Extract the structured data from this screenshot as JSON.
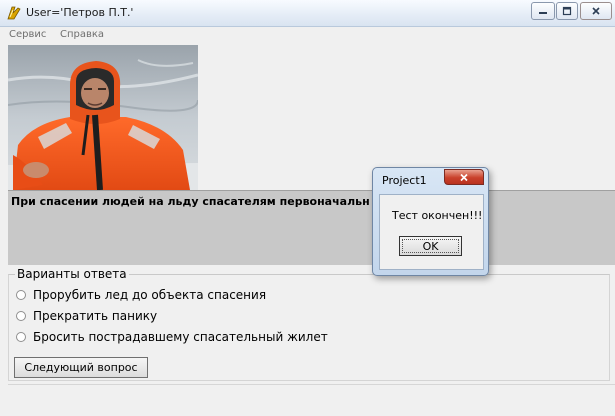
{
  "window": {
    "title": "User='Петров П.Т.'",
    "icon": "delphi-app-icon",
    "controls": [
      "minimize-icon",
      "maximize-icon",
      "close-icon"
    ]
  },
  "menu": {
    "items": [
      {
        "label": "Сервис"
      },
      {
        "label": "Справка"
      }
    ]
  },
  "photo": {
    "icon": "rescuer-photo"
  },
  "question": {
    "text": "При спасении людей на льду спасателям первоначальн"
  },
  "answers": {
    "title": "Варианты ответа",
    "options": [
      {
        "label": "Прорубить лед до объекта спасения"
      },
      {
        "label": "Прекратить панику"
      },
      {
        "label": "Бросить пострадавшему спасательный жилет"
      }
    ]
  },
  "next_button": {
    "label": "Следующий вопрос"
  },
  "dialog": {
    "title": "Project1",
    "message": "Тест окончен!!!",
    "ok_label": "OK"
  },
  "colors": {
    "question_panel": "#c8c8c8",
    "dialog_close": "#c9412b",
    "background": "#f0f0f0"
  }
}
